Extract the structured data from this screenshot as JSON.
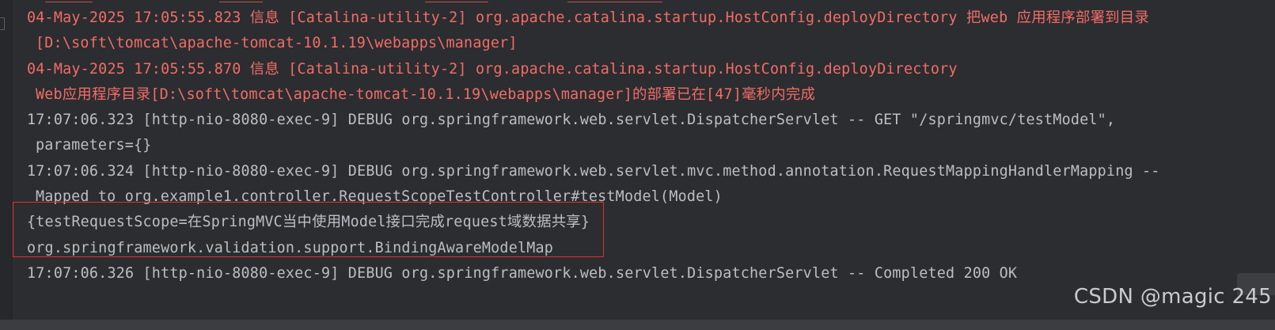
{
  "console": {
    "lines": [
      {
        "text": "04-May-2025 17:05:55.823 信息 [Catalina-utility-2] org.apache.catalina.startup.HostConfig.deployDirectory 把web 应用程序部署到目录"
      },
      {
        "text": "[D:\\soft\\tomcat\\apache-tomcat-10.1.19\\webapps\\manager]"
      },
      {
        "text": "04-May-2025 17:05:55.870 信息 [Catalina-utility-2] org.apache.catalina.startup.HostConfig.deployDirectory"
      },
      {
        "text": "Web应用程序目录[D:\\soft\\tomcat\\apache-tomcat-10.1.19\\webapps\\manager]的部署已在[47]毫秒内完成"
      },
      {
        "text": "17:07:06.323 [http-nio-8080-exec-9] DEBUG org.springframework.web.servlet.DispatcherServlet -- GET \"/springmvc/testModel\","
      },
      {
        "text": "parameters={}"
      },
      {
        "text": "17:07:06.324 [http-nio-8080-exec-9] DEBUG org.springframework.web.servlet.mvc.method.annotation.RequestMappingHandlerMapping --"
      },
      {
        "text": "Mapped to org.example1.controller.RequestScopeTestController#testModel(Model)"
      },
      {
        "text": "{testRequestScope=在SpringMVC当中使用Model接口完成request域数据共享}"
      },
      {
        "text": "org.springframework.validation.support.BindingAwareModelMap"
      },
      {
        "text": "17:07:06.326 [http-nio-8080-exec-9] DEBUG org.springframework.web.servlet.DispatcherServlet -- Completed 200 OK"
      }
    ]
  },
  "watermark": "CSDN @magic 245",
  "colors": {
    "background": "#2b2d30",
    "error_text": "#f26c67",
    "normal_text": "#bcbec4",
    "highlight_box": "#e0312b"
  }
}
